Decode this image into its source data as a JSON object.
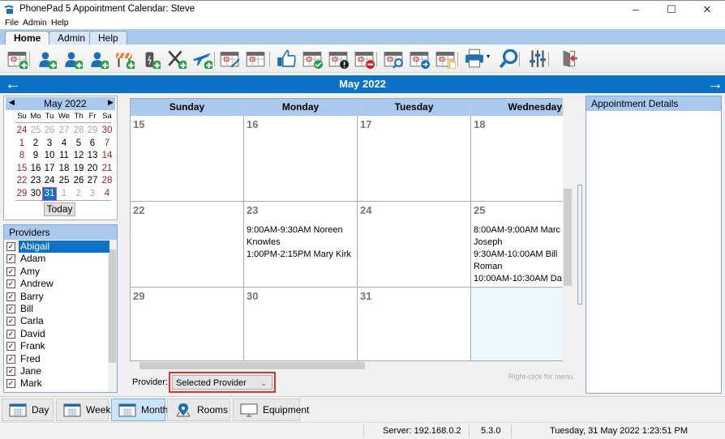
{
  "window": {
    "title": "PhonePad 5 Appointment Calendar: Steve",
    "controls": {
      "minimize": "–",
      "maximize": "☐",
      "close": "✕"
    }
  },
  "menu": [
    "File",
    "Admin",
    "Help"
  ],
  "ribbon_tabs": [
    {
      "label": "Home",
      "active": true
    },
    {
      "label": "Admin",
      "active": false
    },
    {
      "label": "Help",
      "active": false
    }
  ],
  "toolbar_icons": [
    "new-appointment-icon",
    "add-user-icon",
    "add-staff-icon",
    "add-group-icon",
    "add-blocked-time-icon",
    "add-equipment-icon",
    "add-lunch-icon",
    "add-travel-icon",
    "edit-appointment-icon",
    "view-appointment-icon",
    "thumbs-up-icon",
    "confirm-appointment-icon",
    "flag-appointment-icon",
    "cancel-appointment-icon",
    "find-appointment-icon",
    "move-appointment-icon",
    "copy-appointment-icon",
    "print-icon",
    "search-icon",
    "settings-sliders-icon",
    "exit-icon"
  ],
  "month_nav": {
    "title": "May 2022",
    "prev": "←",
    "next": "→"
  },
  "mini_calendar": {
    "title": "May 2022",
    "prev": "◀",
    "next": "▶",
    "weekdays": [
      "Su",
      "Mo",
      "Tu",
      "We",
      "Th",
      "Fr",
      "Sa"
    ],
    "weeks": [
      [
        "24",
        "25",
        "26",
        "27",
        "28",
        "29",
        "30"
      ],
      [
        "1",
        "2",
        "3",
        "4",
        "5",
        "6",
        "7"
      ],
      [
        "8",
        "9",
        "10",
        "11",
        "12",
        "13",
        "14"
      ],
      [
        "15",
        "16",
        "17",
        "18",
        "19",
        "20",
        "21"
      ],
      [
        "22",
        "23",
        "24",
        "25",
        "26",
        "27",
        "28"
      ],
      [
        "29",
        "30",
        "31",
        "1",
        "2",
        "3",
        "4"
      ]
    ],
    "selected": "31",
    "today_label": "Today"
  },
  "providers": {
    "header": "Providers",
    "items": [
      {
        "name": "Abigail",
        "checked": true,
        "selected": true
      },
      {
        "name": "Adam",
        "checked": true
      },
      {
        "name": "Amy",
        "checked": true
      },
      {
        "name": "Andrew",
        "checked": true
      },
      {
        "name": "Barry",
        "checked": true
      },
      {
        "name": "Bill",
        "checked": true
      },
      {
        "name": "Carla",
        "checked": true
      },
      {
        "name": "David",
        "checked": true
      },
      {
        "name": "Frank",
        "checked": true
      },
      {
        "name": "Fred",
        "checked": true
      },
      {
        "name": "Jane",
        "checked": true
      },
      {
        "name": "Mark",
        "checked": true
      }
    ]
  },
  "calendar": {
    "day_headers": [
      "Sunday",
      "Monday",
      "Tuesday",
      "Wednesday"
    ],
    "weeks": [
      [
        {
          "day": "15",
          "appts": ""
        },
        {
          "day": "16",
          "appts": ""
        },
        {
          "day": "17",
          "appts": ""
        },
        {
          "day": "18",
          "appts": ""
        }
      ],
      [
        {
          "day": "22",
          "appts": ""
        },
        {
          "day": "23",
          "appts": "9:00AM-9:30AM Noreen Knowles\n1:00PM-2:15PM Mary Kirk"
        },
        {
          "day": "24",
          "appts": ""
        },
        {
          "day": "25",
          "appts": "8:00AM-9:00AM Marc Joseph\n9:30AM-10:00AM Bill Roman\n10:00AM-10:30AM Da"
        }
      ],
      [
        {
          "day": "29",
          "appts": ""
        },
        {
          "day": "30",
          "appts": ""
        },
        {
          "day": "31",
          "appts": ""
        },
        {
          "day": "",
          "appts": ""
        }
      ]
    ]
  },
  "details": {
    "header": "Appointment Details"
  },
  "provider_filter": {
    "label": "Provider:",
    "value": "Selected Provider",
    "hint": "Right-click for menu."
  },
  "views": [
    {
      "label": "Day",
      "icon": "calendar-day-icon",
      "active": false
    },
    {
      "label": "Week",
      "icon": "calendar-week-icon",
      "active": false
    },
    {
      "label": "Month",
      "icon": "calendar-month-icon",
      "active": true
    },
    {
      "label": "Rooms",
      "icon": "map-pin-icon",
      "active": false
    },
    {
      "label": "Equipment",
      "icon": "projector-icon",
      "active": false
    }
  ],
  "status": {
    "server": "Server: 192.168.0.2",
    "version": "5.3.0",
    "datetime": "Tuesday, 31 May 2022  1:23:51 PM"
  },
  "colors": {
    "accent": "#0b72c7",
    "header_blue": "#a9c9ee",
    "weekend_red": "#a02020",
    "highlight_red": "#e03030"
  }
}
